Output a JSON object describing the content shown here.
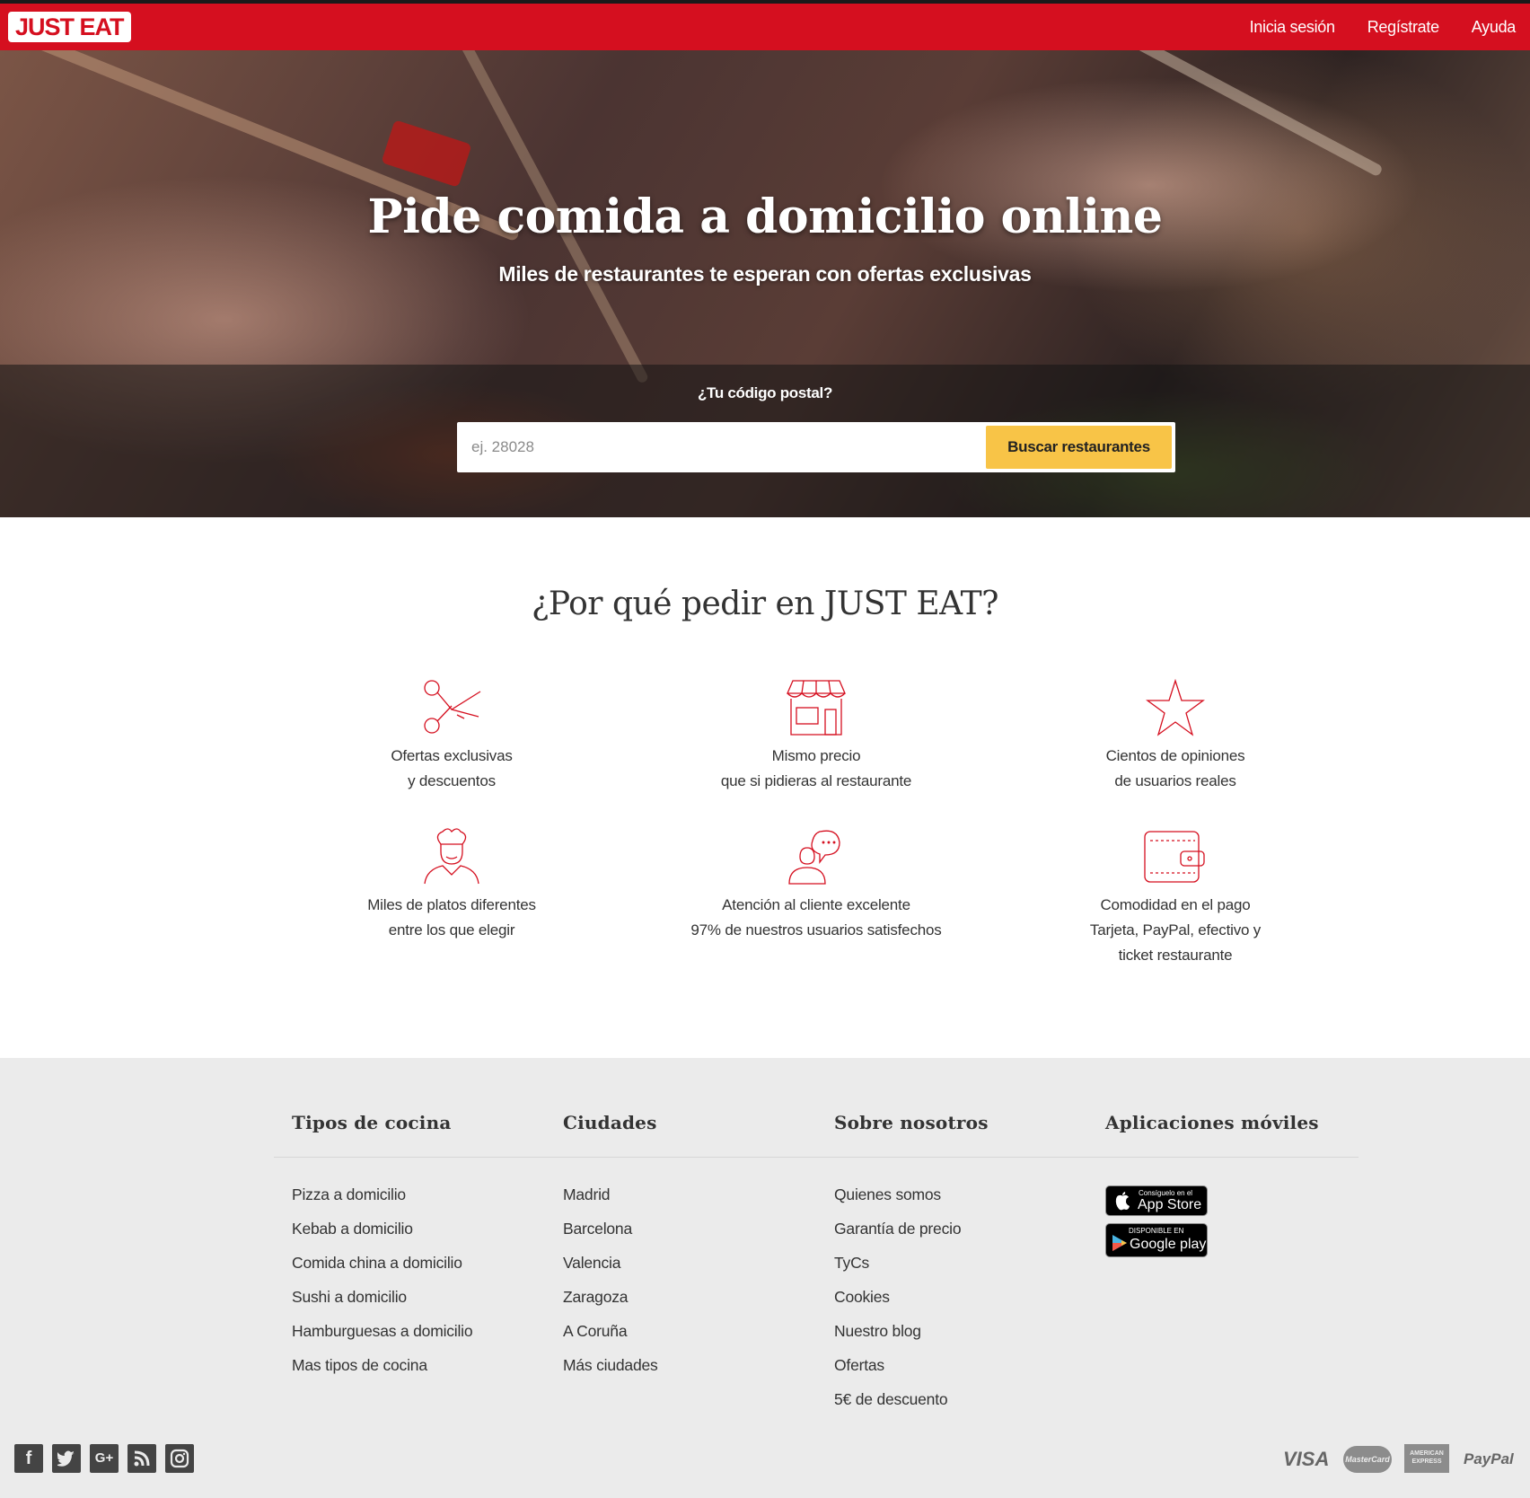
{
  "header": {
    "logo": "JUST EAT",
    "nav": [
      "Inicia sesión",
      "Regístrate",
      "Ayuda"
    ]
  },
  "hero": {
    "title": "Pide comida a domicilio online",
    "subtitle": "Miles de restaurantes te esperan con ofertas exclusivas",
    "postcode_label": "¿Tu código postal?",
    "postcode_placeholder": "ej. 28028",
    "search_button": "Buscar restaurantes"
  },
  "why": {
    "title": "¿Por qué pedir en JUST EAT?",
    "features": [
      {
        "icon": "scissors-icon",
        "line1": "Ofertas exclusivas",
        "line2": "y descuentos",
        "line3": ""
      },
      {
        "icon": "shop-icon",
        "line1": "Mismo precio",
        "line2": "que si pidieras al restaurante",
        "line3": ""
      },
      {
        "icon": "star-icon",
        "line1": "Cientos de opiniones",
        "line2": "de usuarios reales",
        "line3": ""
      },
      {
        "icon": "chef-icon",
        "line1": "Miles de platos diferentes",
        "line2": "entre los que elegir",
        "line3": ""
      },
      {
        "icon": "support-chat-icon",
        "line1": "Atención al cliente excelente",
        "line2": "97% de nuestros usuarios satisfechos",
        "line3": ""
      },
      {
        "icon": "wallet-icon",
        "line1": "Comodidad en el pago",
        "line2": "Tarjeta, PayPal, efectivo y",
        "line3": "ticket restaurante"
      }
    ]
  },
  "footer": {
    "cuisines": {
      "title": "Tipos de cocina",
      "links": [
        "Pizza a domicilio",
        "Kebab a domicilio",
        "Comida china a domicilio",
        "Sushi a domicilio",
        "Hamburguesas a domicilio",
        "Mas tipos de cocina"
      ]
    },
    "cities": {
      "title": "Ciudades",
      "links": [
        "Madrid",
        "Barcelona",
        "Valencia",
        "Zaragoza",
        "A Coruña",
        "Más ciudades"
      ]
    },
    "about": {
      "title": "Sobre nosotros",
      "links": [
        "Quienes somos",
        "Garantía de precio",
        "TyCs",
        "Cookies",
        "Nuestro blog",
        "Ofertas",
        "5€ de descuento"
      ]
    },
    "apps": {
      "title": "Aplicaciones móviles",
      "appstore_small": "Consíguelo en el",
      "appstore_big": "App Store",
      "googleplay_small": "DISPONIBLE EN",
      "googleplay_big": "Google play"
    },
    "social": [
      "facebook-icon",
      "twitter-icon",
      "google-plus-icon",
      "rss-icon",
      "instagram-icon"
    ],
    "payments": [
      "VISA",
      "MasterCard",
      "AMERICAN EXPRESS",
      "PayPal"
    ]
  },
  "colors": {
    "brand_red": "#d50f1f",
    "button_yellow": "#f8c447",
    "footer_bg": "#ebebeb"
  }
}
